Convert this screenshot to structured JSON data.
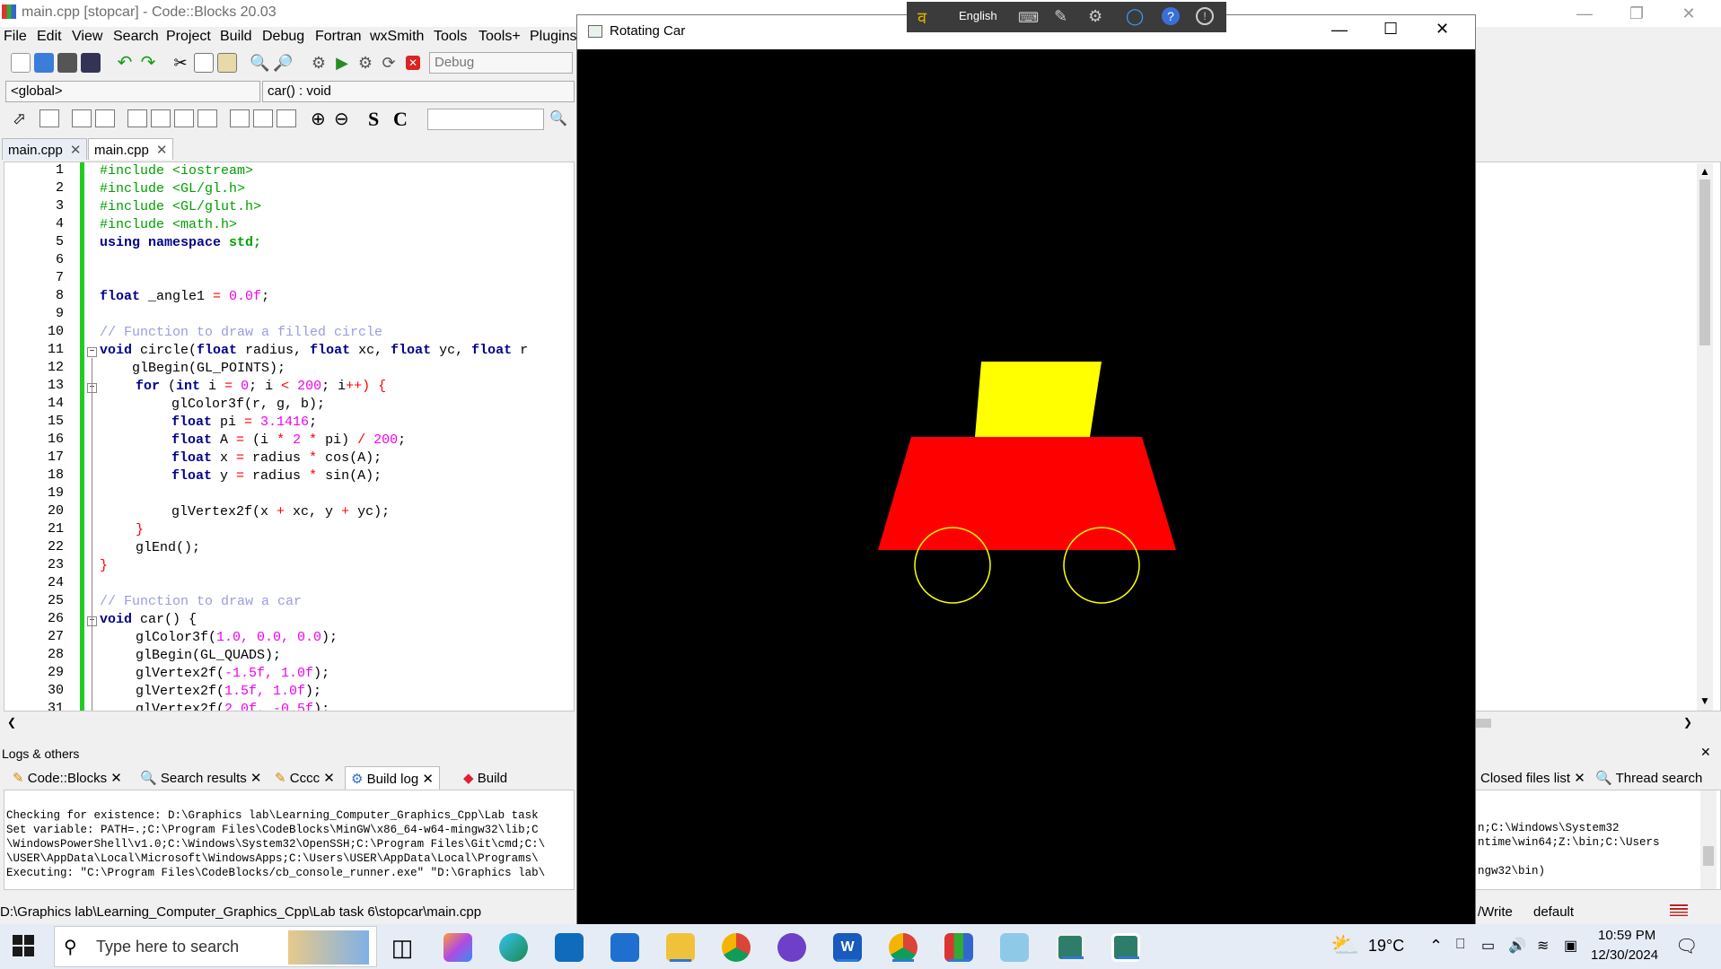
{
  "ide": {
    "title": "main.cpp [stopcar] - Code::Blocks 20.03",
    "menu": [
      "File",
      "Edit",
      "View",
      "Search",
      "Project",
      "Build",
      "Debug",
      "Fortran",
      "wxSmith",
      "Tools",
      "Tools+",
      "Plugins"
    ],
    "build_target": "Debug",
    "scope": "<global>",
    "function": "car() : void",
    "tabs": [
      "main.cpp",
      "main.cpp"
    ],
    "line_numbers": [
      "1",
      "2",
      "3",
      "4",
      "5",
      "6",
      "7",
      "8",
      "9",
      "10",
      "11",
      "12",
      "13",
      "14",
      "15",
      "16",
      "17",
      "18",
      "19",
      "20",
      "21",
      "22",
      "23",
      "24",
      "25",
      "26",
      "27",
      "28",
      "29",
      "30",
      "31"
    ],
    "code": {
      "l1_pp": "#include <iostream>",
      "l2_pp": "#include <GL/gl.h>",
      "l3_pp": "#include <GL/glut.h>",
      "l4_pp": "#include <math.h>",
      "l5_kw": "using namespace",
      "l5_id": "std;",
      "l8_kw": "float",
      "l8_id": " _angle1 ",
      "l8_op": "=",
      "l8_nm": " 0.0f",
      "l8_end": ";",
      "l10_cm": "// Function to draw a filled circle",
      "l11_kw": "void",
      "l11_a": " circle(",
      "l11_kw2": "float",
      "l11_b": " radius, ",
      "l11_kw3": "float",
      "l11_c": " xc, ",
      "l11_kw4": "float",
      "l11_d": " yc, ",
      "l11_kw5": "float",
      "l11_e": " r",
      "l12": "    glBegin(GL_POINTS);",
      "l13_kw": "for",
      "l13_a": " (",
      "l13_kw2": "int",
      "l13_b": " i ",
      "l13_op": "=",
      "l13_nm": " 0",
      "l13_c": "; i ",
      "l13_op2": "<",
      "l13_nm2": " 200",
      "l13_d": "; i",
      "l13_op3": "++",
      "l13_e": ") {",
      "l14": "glColor3f(r, g, b);",
      "l15_kw": "float",
      "l15_a": " pi ",
      "l15_op": "=",
      "l15_nm": " 3.1416",
      "l15_b": ";",
      "l16_kw": "float",
      "l16_a": " A ",
      "l16_op": "=",
      "l16_b": " (i ",
      "l16_op2": "*",
      "l16_nm": " 2",
      "l16_op3": " *",
      "l16_c": " pi) ",
      "l16_op4": "/",
      "l16_nm2": " 200",
      "l16_d": ";",
      "l17_kw": "float",
      "l17_a": " x ",
      "l17_op": "=",
      "l17_b": " radius ",
      "l17_op2": "*",
      "l17_c": " cos(A);",
      "l18_kw": "float",
      "l18_a": " y ",
      "l18_op": "=",
      "l18_b": " radius ",
      "l18_op2": "*",
      "l18_c": " sin(A);",
      "l20_a": "glVertex2f(x ",
      "l20_op": "+",
      "l20_b": " xc, y ",
      "l20_op2": "+",
      "l20_c": " yc);",
      "l21": "}",
      "l22": "glEnd();",
      "l23": "}",
      "l25_cm": "// Function to draw a car",
      "l26_kw": "void",
      "l26_a": " car() {",
      "l27_a": "glColor3f(",
      "l27_nm": "1.0, 0.0, 0.0",
      "l27_b": ");",
      "l28": "glBegin(GL_QUADS);",
      "l29_a": "glVertex2f(",
      "l29_nm": "-1.5f, 1.0f",
      "l29_b": ");",
      "l30_a": "glVertex2f(",
      "l30_nm": "1.5f, 1.0f",
      "l30_b": ");",
      "l31_a": "glVertex2f(",
      "l31_nm": "2.0f, -0.5f",
      "l31_b": ");"
    },
    "logs_header": "Logs & others",
    "log_tabs": [
      "Code::Blocks",
      "Search results",
      "Cccc",
      "Build log",
      "Build messages"
    ],
    "log_tabs_right": [
      "Closed files list",
      "Thread search"
    ],
    "log_lines": [
      "Checking for existence: D:\\Graphics lab\\Learning_Computer_Graphics_Cpp\\Lab task",
      "Set variable: PATH=.;C:\\Program Files\\CodeBlocks\\MinGW\\x86_64-w64-mingw32\\lib;C",
      "\\WindowsPowerShell\\v1.0;C:\\Windows\\System32\\OpenSSH;C:\\Program Files\\Git\\cmd;C:\\",
      "\\USER\\AppData\\Local\\Microsoft\\WindowsApps;C:\\Users\\USER\\AppData\\Local\\Programs\\",
      "Executing: \"C:\\Program Files\\CodeBlocks/cb_console_runner.exe\" \"D:\\Graphics lab\\"
    ],
    "log_lines_right": [
      "n;C:\\Windows\\System32",
      "ntime\\win64;Z:\\bin;C:\\Users",
      "",
      "ngw32\\bin)"
    ],
    "status_path": "D:\\Graphics lab\\Learning_Computer_Graphics_Cpp\\Lab task 6\\stopcar\\main.cpp",
    "status_rw": "/Write",
    "status_default": "default"
  },
  "car_window": {
    "title": "Rotating Car",
    "colors": {
      "body": "#ff0000",
      "cabin": "#ffff00",
      "wheels": "#ffff00",
      "bg": "#000000"
    }
  },
  "language_bar": {
    "language": "English"
  },
  "taskbar": {
    "search_placeholder": "Type here to search",
    "weather": "19°C",
    "time": "10:59 PM",
    "date": "12/30/2024"
  }
}
